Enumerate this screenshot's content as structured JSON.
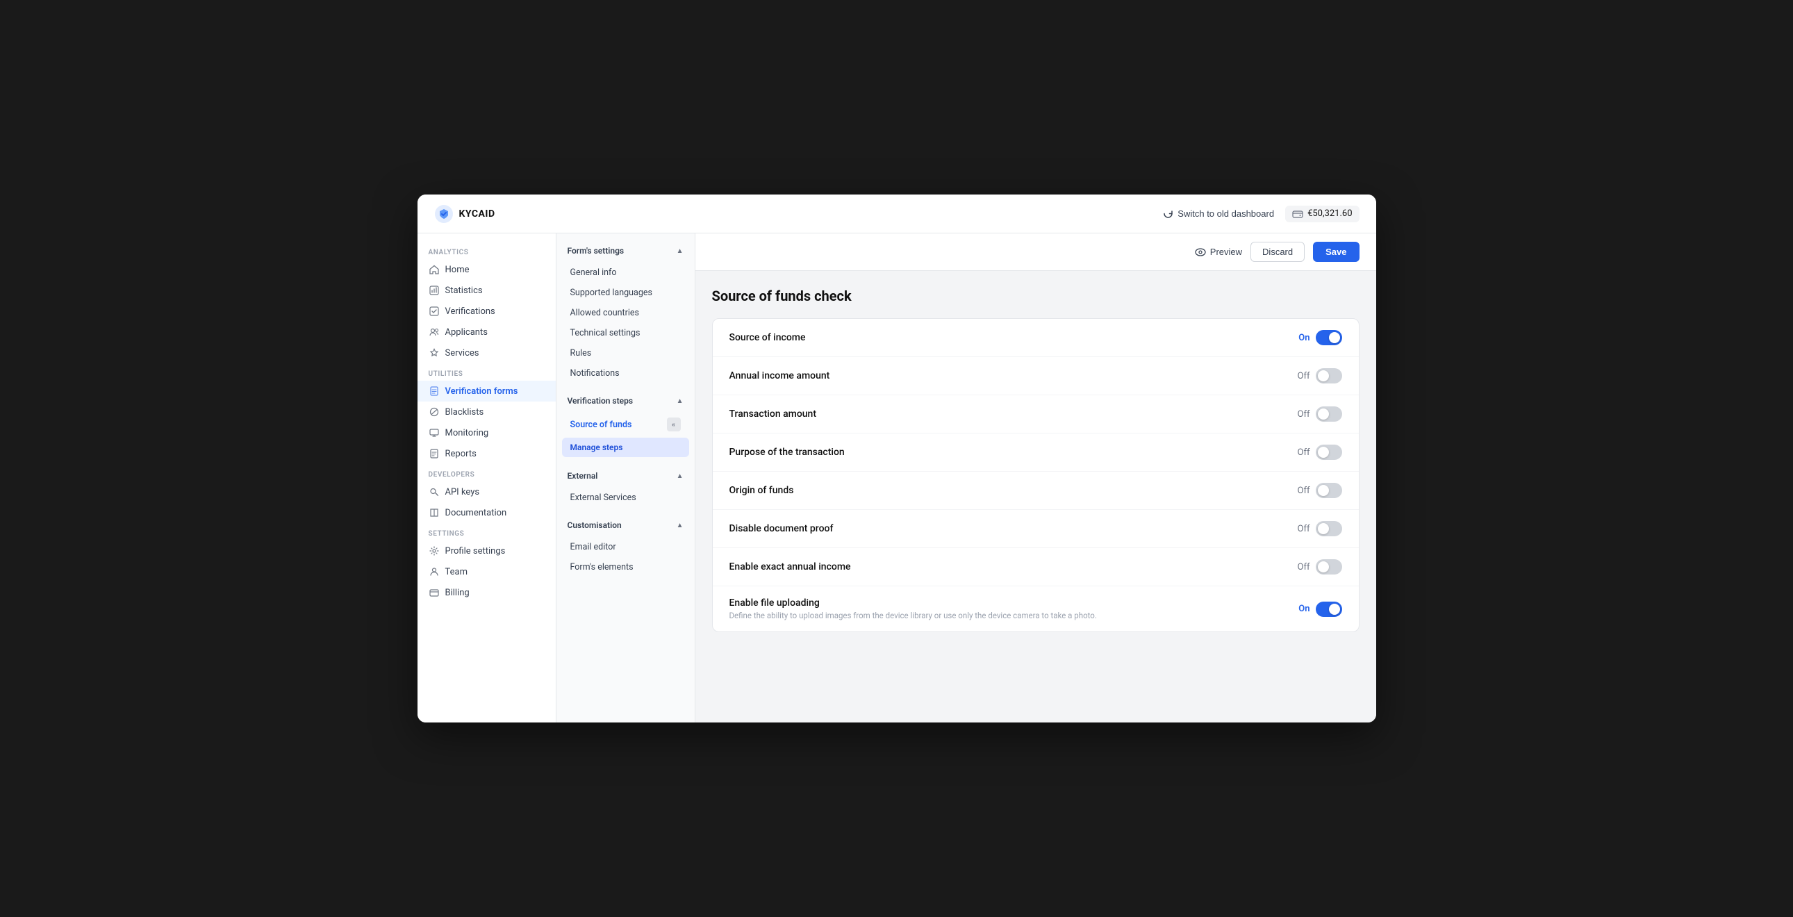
{
  "app": {
    "logo_text": "KYCAID",
    "switch_old_label": "Switch to old dashboard",
    "balance": "€50,321.60"
  },
  "sidebar": {
    "analytics_label": "Analytics",
    "utilities_label": "Utilities",
    "developers_label": "Developers",
    "settings_label": "Settings",
    "items": [
      {
        "id": "home",
        "label": "Home",
        "icon": "home"
      },
      {
        "id": "statistics",
        "label": "Statistics",
        "icon": "stats"
      },
      {
        "id": "verifications",
        "label": "Verifications",
        "icon": "check-square"
      },
      {
        "id": "applicants",
        "label": "Applicants",
        "icon": "users"
      },
      {
        "id": "services",
        "label": "Services",
        "icon": "star"
      },
      {
        "id": "verification-forms",
        "label": "Verification forms",
        "icon": "doc",
        "active": true
      },
      {
        "id": "blacklists",
        "label": "Blacklists",
        "icon": "ban"
      },
      {
        "id": "monitoring",
        "label": "Monitoring",
        "icon": "monitor"
      },
      {
        "id": "reports",
        "label": "Reports",
        "icon": "report"
      },
      {
        "id": "api-keys",
        "label": "API keys",
        "icon": "key"
      },
      {
        "id": "documentation",
        "label": "Documentation",
        "icon": "book"
      },
      {
        "id": "profile-settings",
        "label": "Profile settings",
        "icon": "gear"
      },
      {
        "id": "team",
        "label": "Team",
        "icon": "team"
      },
      {
        "id": "billing",
        "label": "Billing",
        "icon": "billing"
      }
    ]
  },
  "second_sidebar": {
    "sections": [
      {
        "id": "forms-settings",
        "label": "Form's settings",
        "expanded": true,
        "items": [
          {
            "id": "general-info",
            "label": "General info"
          },
          {
            "id": "supported-languages",
            "label": "Supported languages"
          },
          {
            "id": "allowed-countries",
            "label": "Allowed countries"
          },
          {
            "id": "technical-settings",
            "label": "Technical settings"
          },
          {
            "id": "rules",
            "label": "Rules"
          },
          {
            "id": "notifications",
            "label": "Notifications"
          }
        ]
      },
      {
        "id": "verification-steps",
        "label": "Verification steps",
        "expanded": true,
        "items": [
          {
            "id": "source-of-funds",
            "label": "Source of funds",
            "active": true
          },
          {
            "id": "manage-steps",
            "label": "Manage steps",
            "special": true
          }
        ]
      },
      {
        "id": "external",
        "label": "External",
        "expanded": true,
        "items": [
          {
            "id": "external-services",
            "label": "External Services"
          }
        ]
      },
      {
        "id": "customisation",
        "label": "Customisation",
        "expanded": true,
        "items": [
          {
            "id": "email-editor",
            "label": "Email editor"
          },
          {
            "id": "forms-elements",
            "label": "Form's elements"
          }
        ]
      }
    ]
  },
  "toolbar": {
    "preview_label": "Preview",
    "discard_label": "Discard",
    "save_label": "Save"
  },
  "main": {
    "page_title": "Source of funds check",
    "settings_rows": [
      {
        "id": "source-of-income",
        "label": "Source of income",
        "sublabel": "",
        "toggle_state": "on"
      },
      {
        "id": "annual-income-amount",
        "label": "Annual income amount",
        "sublabel": "",
        "toggle_state": "off"
      },
      {
        "id": "transaction-amount",
        "label": "Transaction amount",
        "sublabel": "",
        "toggle_state": "off"
      },
      {
        "id": "purpose-of-transaction",
        "label": "Purpose of the transaction",
        "sublabel": "",
        "toggle_state": "off"
      },
      {
        "id": "origin-of-funds",
        "label": "Origin of funds",
        "sublabel": "",
        "toggle_state": "off"
      },
      {
        "id": "disable-document-proof",
        "label": "Disable document proof",
        "sublabel": "",
        "toggle_state": "off"
      },
      {
        "id": "enable-exact-annual-income",
        "label": "Enable exact annual income",
        "sublabel": "",
        "toggle_state": "off"
      },
      {
        "id": "enable-file-uploading",
        "label": "Enable file uploading",
        "sublabel": "Define the ability to upload images from the device library or use only the device camera to take a photo.",
        "toggle_state": "on"
      }
    ]
  }
}
